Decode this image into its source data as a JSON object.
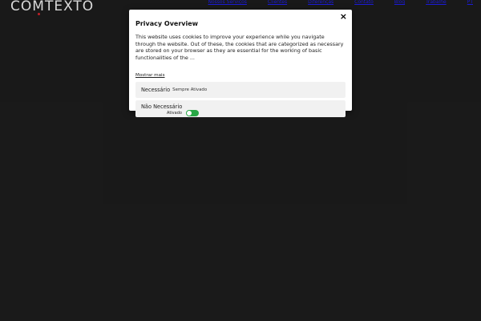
{
  "site": {
    "logo_parts": [
      "CO",
      "M",
      "TEXTO"
    ]
  },
  "nav": {
    "items": [
      "Nossos Serviços",
      "Clientes",
      "Diferenças",
      "Contato",
      "Blog",
      "Trabalhe",
      "PT"
    ]
  },
  "cookie_modal": {
    "close_icon": "×",
    "title": "Privacy Overview",
    "description": "This website uses cookies to improve your experience while you navigate through the website. Out of these, the cookies that are categorized as necessary are stored on your browser as they are essential for the working of basic functionalities of the ...",
    "show_more": "Mostrar mais",
    "categories": [
      {
        "name": "Necessário",
        "status": "Sempre Ativado"
      },
      {
        "name": "Não Necessário",
        "toggle_label": "Ativado",
        "enabled": true
      }
    ]
  },
  "colors": {
    "background": "#1e1e1e",
    "toggle_on": "#28a745",
    "logo_dot": "#e3262e",
    "nav_link": "#1f1fff"
  }
}
